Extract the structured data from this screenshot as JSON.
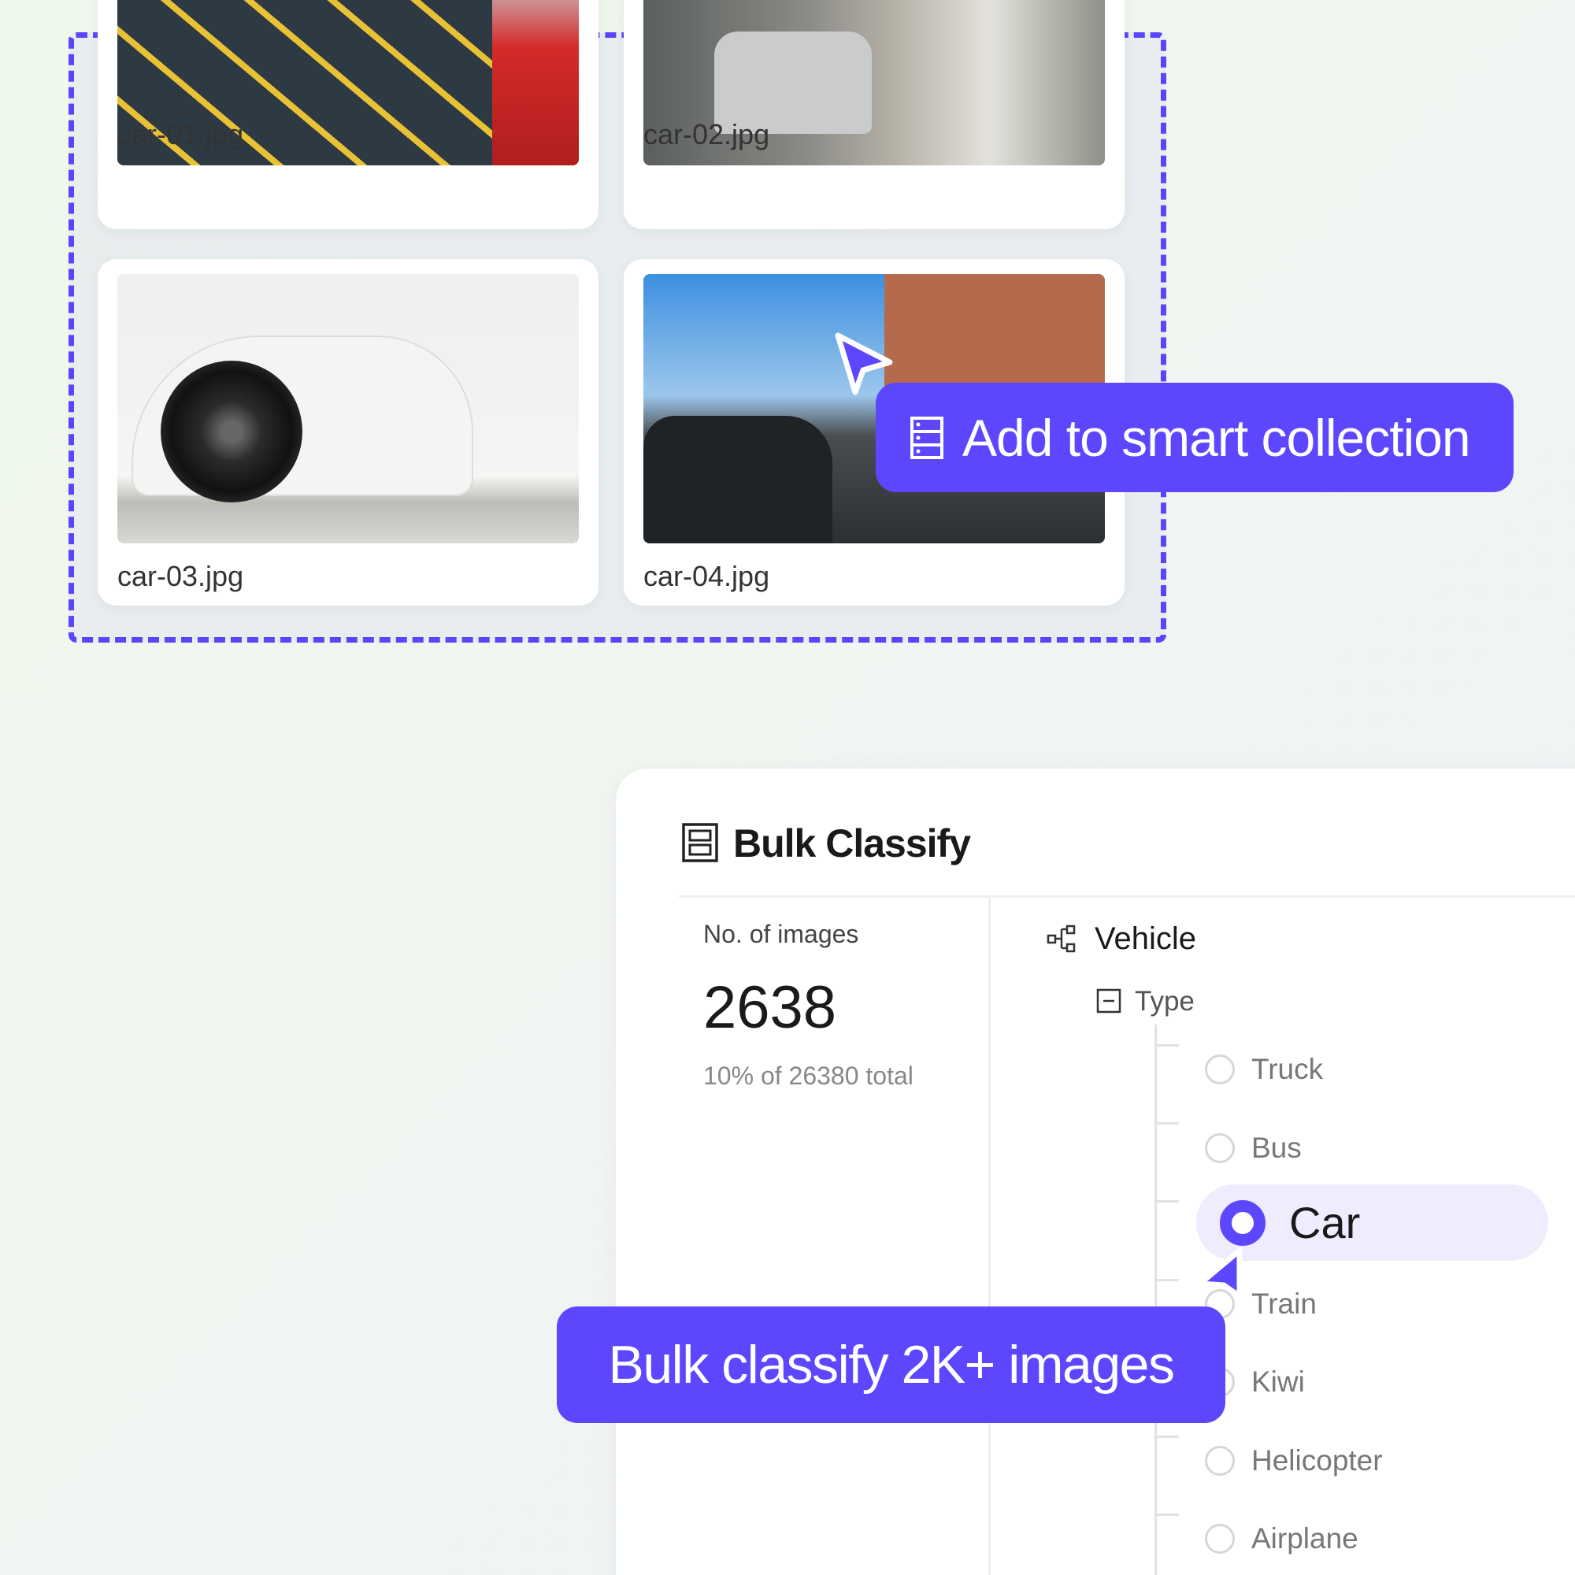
{
  "accent": "#5c47ff",
  "images": [
    {
      "name": "car-01.jpg"
    },
    {
      "name": "car-02.jpg"
    },
    {
      "name": "car-03.jpg"
    },
    {
      "name": "car-04.jpg"
    }
  ],
  "smart_collection": {
    "label": "Add to smart collection",
    "icon": "collection-icon"
  },
  "bulk_classify_callout": {
    "label": "Bulk classify 2K+ images"
  },
  "panel": {
    "title": "Bulk Classify",
    "stats": {
      "label": "No. of images",
      "value": "2638",
      "subtext": "10% of 26380 total"
    },
    "category": "Vehicle",
    "group": "Type",
    "options": [
      {
        "label": "Truck",
        "selected": false
      },
      {
        "label": "Bus",
        "selected": false
      },
      {
        "label": "Car",
        "selected": true
      },
      {
        "label": "Train",
        "selected": false
      },
      {
        "label": "Kiwi",
        "selected": false
      },
      {
        "label": "Helicopter",
        "selected": false
      },
      {
        "label": "Airplane",
        "selected": false
      }
    ]
  }
}
